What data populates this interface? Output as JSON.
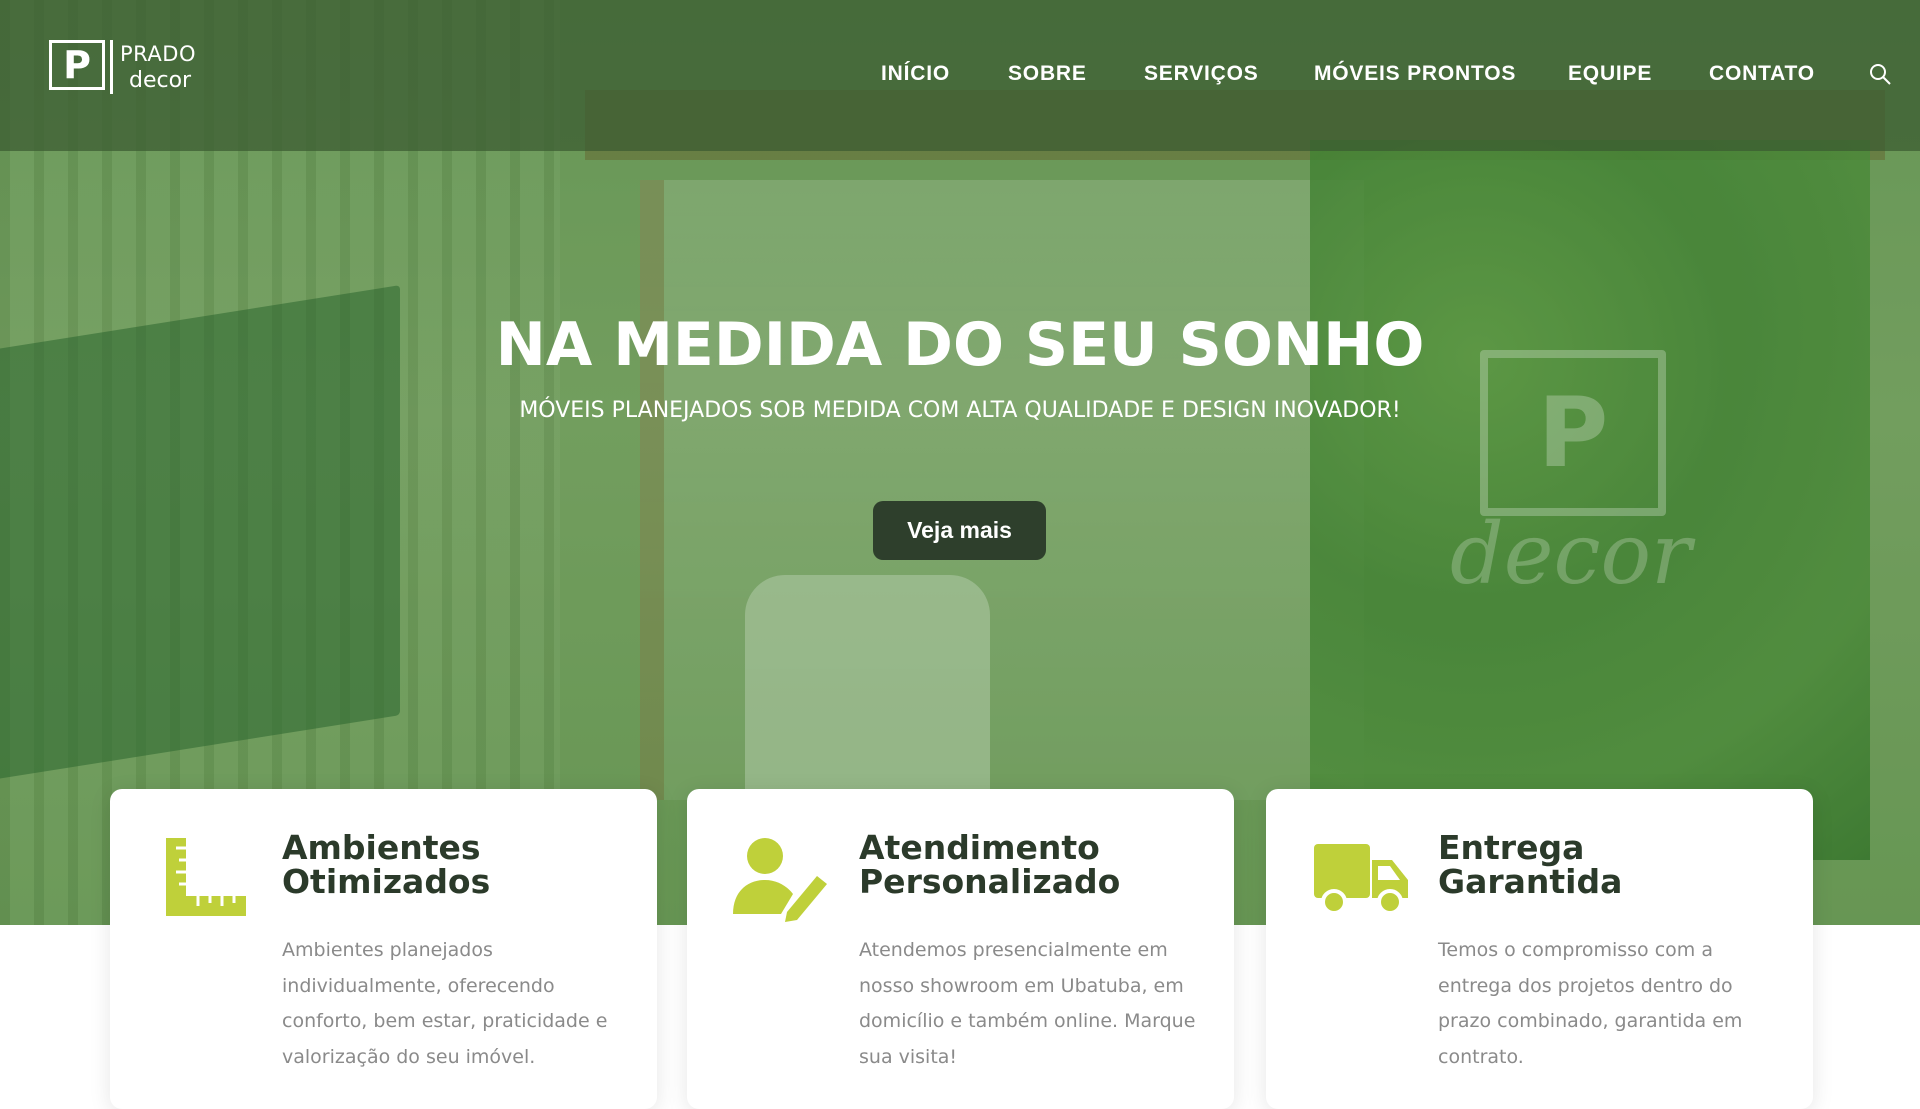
{
  "brand": {
    "logo_letter": "P",
    "name": "PRADO",
    "sub": "decor"
  },
  "nav": {
    "items": [
      {
        "label": "INÍCIO"
      },
      {
        "label": "SOBRE"
      },
      {
        "label": "SERVIÇOS"
      },
      {
        "label": "MÓVEIS PRONTOS"
      },
      {
        "label": "EQUIPE"
      },
      {
        "label": "CONTATO"
      }
    ],
    "search_icon": "search-icon"
  },
  "hero": {
    "title": "NA MEDIDA DO SEU SONHO",
    "subtitle": "MÓVEIS PLANEJADOS SOB MEDIDA COM ALTA QUALIDADE E DESIGN INOVADOR!",
    "button_label": "Veja mais"
  },
  "features": [
    {
      "icon": "ruler-square-icon",
      "title_line1": "Ambientes",
      "title_line2": "Otimizados",
      "text": "Ambientes planejados individualmente, oferecendo conforto, bem estar, praticidade e valorização do seu imóvel."
    },
    {
      "icon": "user-edit-icon",
      "title_line1": "Atendimento",
      "title_line2": "Personalizado",
      "text": "Atendemos presencialmente em nosso showroom em Ubatuba, em domicílio e também online. Marque sua visita!"
    },
    {
      "icon": "delivery-truck-icon",
      "title_line1": "Entrega",
      "title_line2": "Garantida",
      "text": "Temos o compromisso com a entrega dos projetos dentro do prazo combinado, garantida em contrato."
    }
  ],
  "colors": {
    "accent": "#bfd03a",
    "button_bg": "#2e3f2c",
    "header_overlay": "#3a5a30",
    "card_title": "#2b3a2a",
    "card_text": "#8a8a8a"
  }
}
